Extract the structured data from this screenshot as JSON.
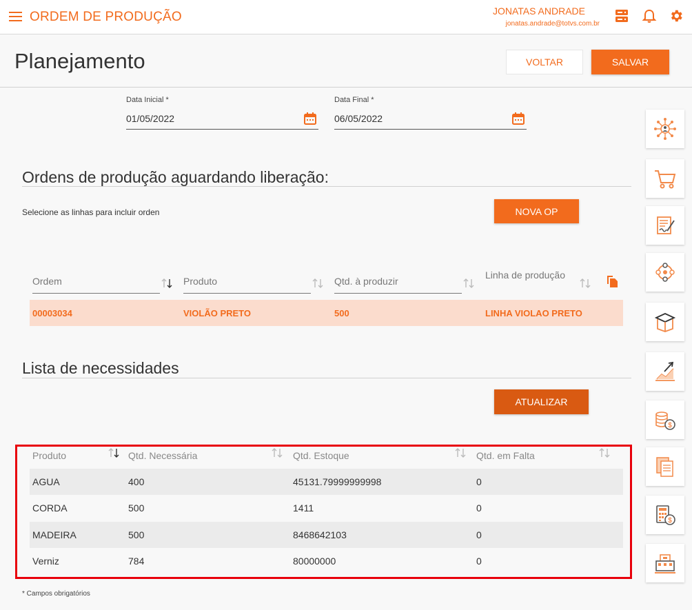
{
  "header": {
    "app_title": "ORDEM DE PRODUÇÃO",
    "user_name": "JONATAS ANDRADE",
    "user_email": "jonatas.andrade@totvs.com.br",
    "icons": [
      "menu-icon",
      "server-icon",
      "bell-icon",
      "gear-icon"
    ],
    "accent_color": "#f26b1d"
  },
  "page": {
    "title": "Planejamento",
    "voltar_label": "VOLTAR",
    "salvar_label": "SALVAR"
  },
  "form": {
    "data_inicial_label": "Data Inicial *",
    "data_inicial_value": "01/05/2022",
    "data_final_label": "Data Final *",
    "data_final_value": "06/05/2022"
  },
  "orders_section": {
    "title": "Ordens de produção aguardando liberação:",
    "helper": "Selecione as linhas para incluir orden",
    "nova_op_label": "NOVA OP",
    "columns": [
      "Ordem",
      "Produto",
      "Qtd. à produzir",
      "Linha de produção"
    ],
    "rows": [
      {
        "ordem": "00003034",
        "produto": "VIOLÃO PRETO",
        "qtd": "500",
        "linha": "LINHA VIOLAO PRETO"
      }
    ],
    "selected_row_color": "#fbdccd"
  },
  "needs_section": {
    "title": "Lista de necessidades",
    "atualizar_label": "ATUALIZAR",
    "columns": [
      "Produto",
      "Qtd. Necessária",
      "Qtd. Estoque",
      "Qtd. em Falta"
    ],
    "rows": [
      {
        "produto": "AGUA",
        "necessaria": "400",
        "estoque": "45131.79999999998",
        "falta": "0"
      },
      {
        "produto": "CORDA",
        "necessaria": "500",
        "estoque": "1411",
        "falta": "0"
      },
      {
        "produto": "MADEIRA",
        "necessaria": "500",
        "estoque": "8468642103",
        "falta": "0"
      },
      {
        "produto": "Verniz",
        "necessaria": "784",
        "estoque": "80000000",
        "falta": "0"
      }
    ],
    "highlight_color": "#e8000b"
  },
  "footer": {
    "note": "* Campos obrigatórios"
  },
  "sidebar": {
    "items": [
      "network-person-icon",
      "cart-icon",
      "contract-sign-icon",
      "process-cycle-icon",
      "box-icon",
      "growth-chart-icon",
      "coins-icon",
      "documents-icon",
      "calculator-money-icon",
      "factory-icon"
    ]
  }
}
